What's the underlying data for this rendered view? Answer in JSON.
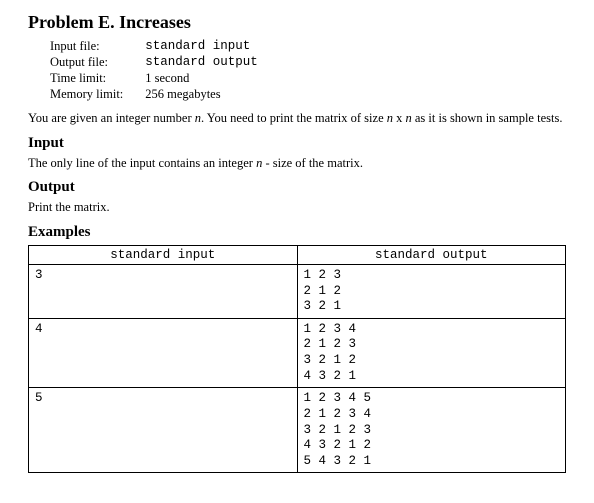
{
  "title": "Problem E. Increases",
  "limits": {
    "input_file_label": "Input file:",
    "input_file_value": "standard input",
    "output_file_label": "Output file:",
    "output_file_value": "standard output",
    "time_limit_label": "Time limit:",
    "time_limit_value": "1 second",
    "memory_limit_label": "Memory limit:",
    "memory_limit_value": "256 megabytes"
  },
  "statement": {
    "p1a": "You are given an integer number ",
    "n1": "n",
    "p1b": ". You need to print the matrix of size ",
    "n2": "n",
    "x": " x ",
    "n3": "n",
    "p1c": " as it is shown in sample tests."
  },
  "sections": {
    "input": "Input",
    "output": "Output",
    "examples": "Examples"
  },
  "input_text": {
    "a": "The only line of the input contains an integer ",
    "n": "n",
    "b": " - size of the matrix."
  },
  "output_text": "Print the matrix.",
  "examples": {
    "hdr_in": "standard input",
    "hdr_out": "standard output",
    "rows": [
      {
        "in": "3",
        "out": "1 2 3\n2 1 2\n3 2 1"
      },
      {
        "in": "4",
        "out": "1 2 3 4\n2 1 2 3\n3 2 1 2\n4 3 2 1"
      },
      {
        "in": "5",
        "out": "1 2 3 4 5\n2 1 2 3 4\n3 2 1 2 3\n4 3 2 1 2\n5 4 3 2 1"
      }
    ]
  }
}
